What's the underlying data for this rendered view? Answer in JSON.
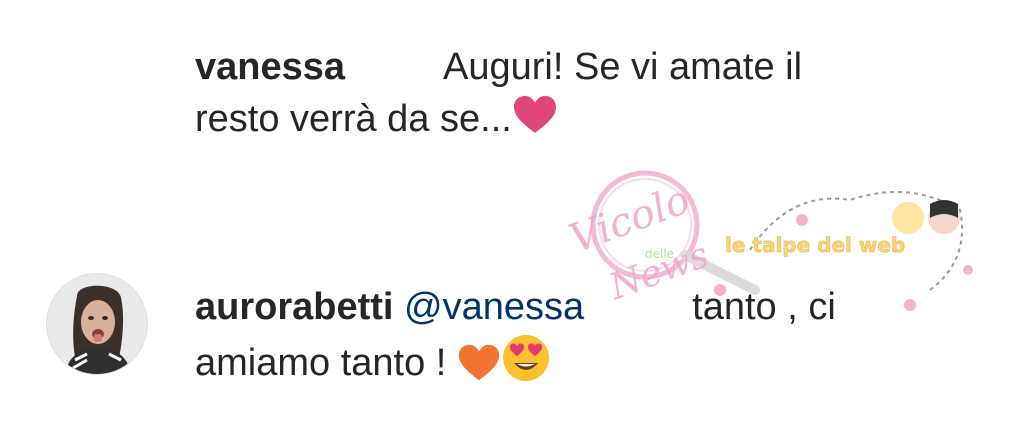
{
  "comments": [
    {
      "username": "vanessa",
      "text_line1": "Auguri! Se vi amate il",
      "text_line2": "resto verrà da se...",
      "emoji": "pink-heart"
    },
    {
      "username": "aurorabetti",
      "mention": "@vanessa",
      "text_line1_end": "tanto , ci",
      "text_line2": "amiamo tanto !",
      "emojis": [
        "orange-heart",
        "heart-eyes-face"
      ]
    }
  ],
  "watermark": {
    "text_left": "Vicolo",
    "text_small": "delle",
    "text_bottom": "News",
    "text_right": "le talpe del web"
  },
  "colors": {
    "username": "#262626",
    "mention": "#003569",
    "pink_heart": "#e0457b",
    "orange_heart": "#f07430"
  }
}
